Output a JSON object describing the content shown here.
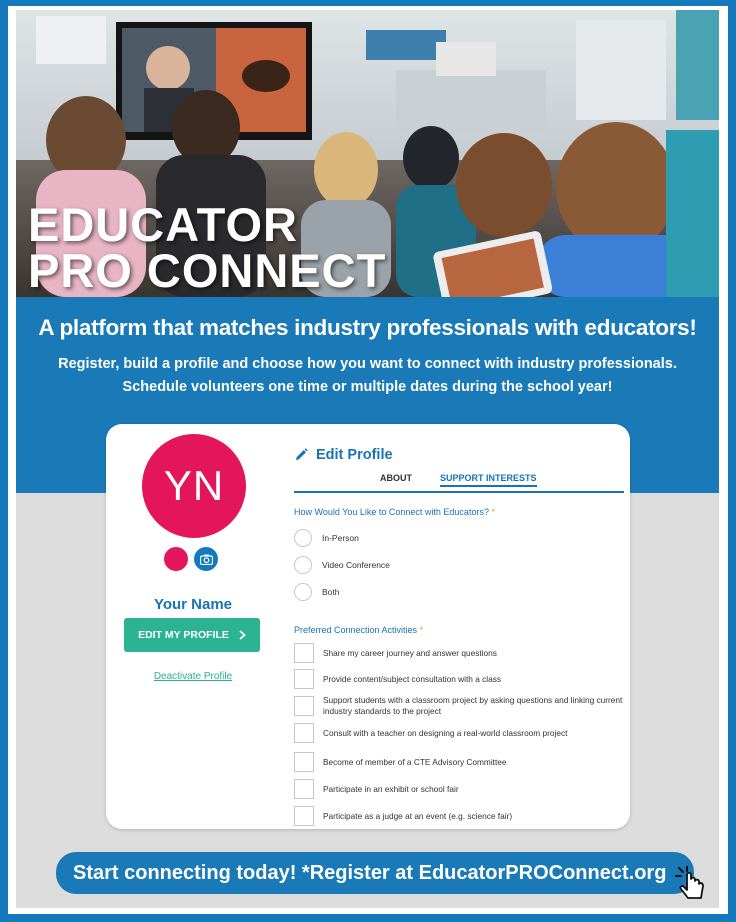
{
  "hero": {
    "title_line1": "EDUCATOR",
    "title_line2": "PRO CONNECT"
  },
  "band": {
    "tagline": "A platform that matches industry professionals with educators!",
    "description_line1": "Register, build a profile and choose how you want to connect with industry professionals.",
    "description_line2": "Schedule volunteers one time or multiple dates during the school year!"
  },
  "profile": {
    "initials": "YN",
    "name": "Your Name",
    "edit_button_label": "EDIT MY PROFILE",
    "deactivate_label": "Deactivate Profile"
  },
  "edit_panel": {
    "heading": "Edit Profile",
    "tabs": [
      {
        "label": "ABOUT"
      },
      {
        "label": "SUPPORT INTERESTS"
      }
    ],
    "connect_question": "How Would You Like to Connect with Educators?",
    "required_mark": "*",
    "connect_options": [
      "In-Person",
      "Video Conference",
      "Both"
    ],
    "activities_title": "Preferred Connection Activities",
    "activities": [
      "Share my career journey and answer questions",
      "Provide content/subject consultation with a class",
      "Support students with a classroom project by asking questions and linking current industry standards to the project",
      "Consult with a teacher on designing a real-world classroom project",
      "Become of member of a CTE Advisory Committee",
      "Participate in an exhibit or school fair",
      "Participate as a judge at an event (e.g. science fair)"
    ]
  },
  "cta": {
    "text": "Start connecting today! *Register at EducatorPROConnect.org"
  },
  "colors": {
    "frame_blue": "#1479bd",
    "band_blue": "#1a7ab8",
    "avatar_pink": "#e3165b",
    "button_green": "#2bb392",
    "accent_orange": "#f3a01c"
  },
  "icons": {
    "edit": "pencil-icon",
    "camera": "camera-icon",
    "chevron": "chevron-right-icon",
    "pointer": "hand-pointer-icon"
  }
}
